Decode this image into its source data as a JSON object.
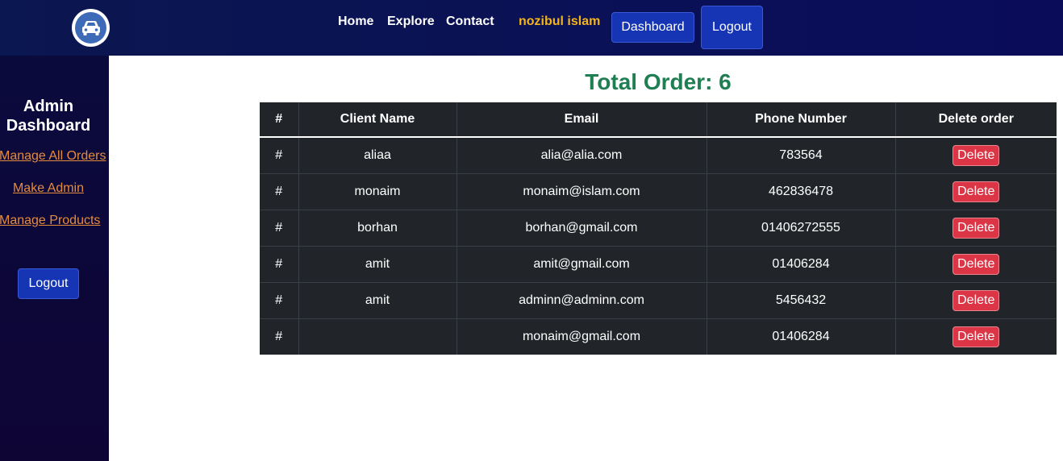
{
  "navbar": {
    "logo_icon": "car-icon",
    "links": [
      "Home",
      "Explore",
      "Contact"
    ],
    "user_name": "nozibul islam",
    "dashboard_label": "Dashboard",
    "logout_label": "Logout"
  },
  "sidebar": {
    "title": "Admin Dashboard",
    "links": [
      "Manage All Orders",
      "Make Admin",
      "Manage Products"
    ],
    "logout_label": "Logout"
  },
  "main": {
    "total_orders": "Total Order: 6",
    "columns": [
      "#",
      "Client Name",
      "Email",
      "Phone Number",
      "Delete order"
    ],
    "rows": [
      {
        "index": "#",
        "name": "aliaa",
        "email": "alia@alia.com",
        "phone": "783564",
        "action": "Delete"
      },
      {
        "index": "#",
        "name": "monaim",
        "email": "monaim@islam.com",
        "phone": "462836478",
        "action": "Delete"
      },
      {
        "index": "#",
        "name": "borhan",
        "email": "borhan@gmail.com",
        "phone": "01406272555",
        "action": "Delete"
      },
      {
        "index": "#",
        "name": "amit",
        "email": "amit@gmail.com",
        "phone": "01406284",
        "action": "Delete"
      },
      {
        "index": "#",
        "name": "amit",
        "email": "adminn@adminn.com",
        "phone": "5456432",
        "action": "Delete"
      },
      {
        "index": "#",
        "name": "",
        "email": "monaim@gmail.com",
        "phone": "01406284",
        "action": "Delete"
      }
    ]
  },
  "colors": {
    "navbar_bg": "#0a0c5a",
    "sidebar_bg": "#0e0535",
    "accent_button": "#1535b4",
    "user_name": "#f4b41a",
    "sidebar_link": "#e58b3c",
    "total_heading": "#1f7e52",
    "delete_button": "#dc3545",
    "table_bg": "#212529"
  }
}
